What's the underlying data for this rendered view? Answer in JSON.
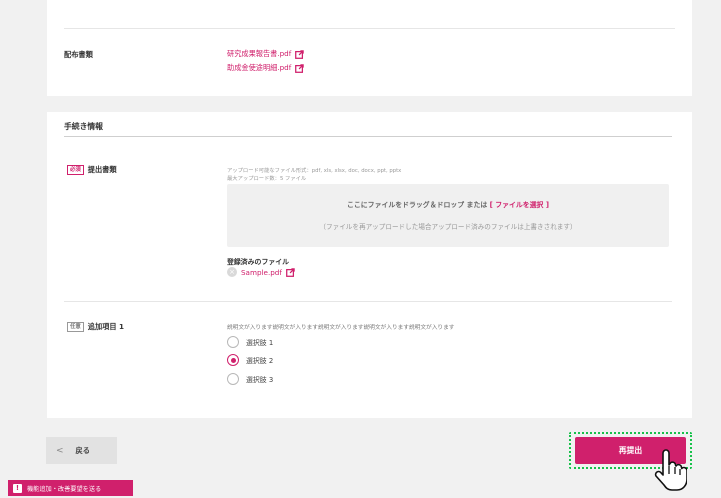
{
  "distribution": {
    "label": "配布書類",
    "files": [
      "研究成果報告書.pdf",
      "助成金使途明細.pdf"
    ]
  },
  "procedure": {
    "section_title": "手続き情報",
    "submission": {
      "badge": "必須",
      "label": "提出書類",
      "note_formats": "アップロード可能なファイル形式：pdf, xls, xlsx, doc, docx, ppt, pptx",
      "note_max": "最大アップロード数：5 ファイル",
      "dropzone_main": "ここにファイルをドラッグ＆ドロップ または",
      "dropzone_link": "[ ファイルを選択 ]",
      "dropzone_sub": "（ファイルを再アップロードした場合アップロード済みのファイルは上書きされます）",
      "registered_title": "登録済みのファイル",
      "registered_file": "Sample.pdf"
    },
    "additional": {
      "badge": "任意",
      "label": "追加項目 1",
      "description": "説明文が入ります説明文が入ります説明文が入ります説明文が入ります説明文が入ります",
      "options": [
        {
          "label": "選択肢 1",
          "checked": false
        },
        {
          "label": "選択肢 2",
          "checked": true
        },
        {
          "label": "選択肢 3",
          "checked": false
        }
      ]
    }
  },
  "footer": {
    "back_label": "戻る",
    "submit_label": "再提出",
    "feedback_label": "機能追加・改善要望を送る"
  },
  "colors": {
    "accent": "#d0206c",
    "highlight": "#18c14b"
  },
  "icons": {
    "external": "external-link-icon",
    "remove": "remove-file-icon",
    "back": "chevron-left-icon",
    "cursor": "hand-pointer-icon",
    "alert": "exclamation-icon"
  }
}
